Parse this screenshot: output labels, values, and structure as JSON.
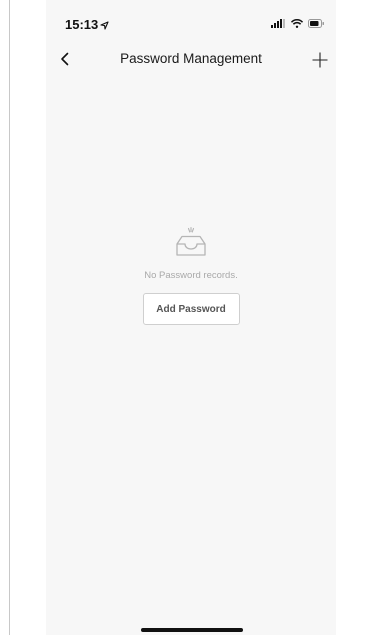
{
  "status_bar": {
    "time": "15:13",
    "location_icon": "location-arrow-icon",
    "signal_icon": "cellular-signal-icon",
    "wifi_icon": "wifi-icon",
    "battery_icon": "battery-icon"
  },
  "nav": {
    "title": "Password Management",
    "back_icon": "chevron-left-icon",
    "add_icon": "plus-icon"
  },
  "empty_state": {
    "icon": "empty-inbox-icon",
    "message": "No Password records.",
    "button_label": "Add Password"
  },
  "colors": {
    "background": "#f7f7f7",
    "text_primary": "#1a1a1a",
    "text_muted": "#a9a9a9",
    "button_border": "#cfcfcf"
  }
}
